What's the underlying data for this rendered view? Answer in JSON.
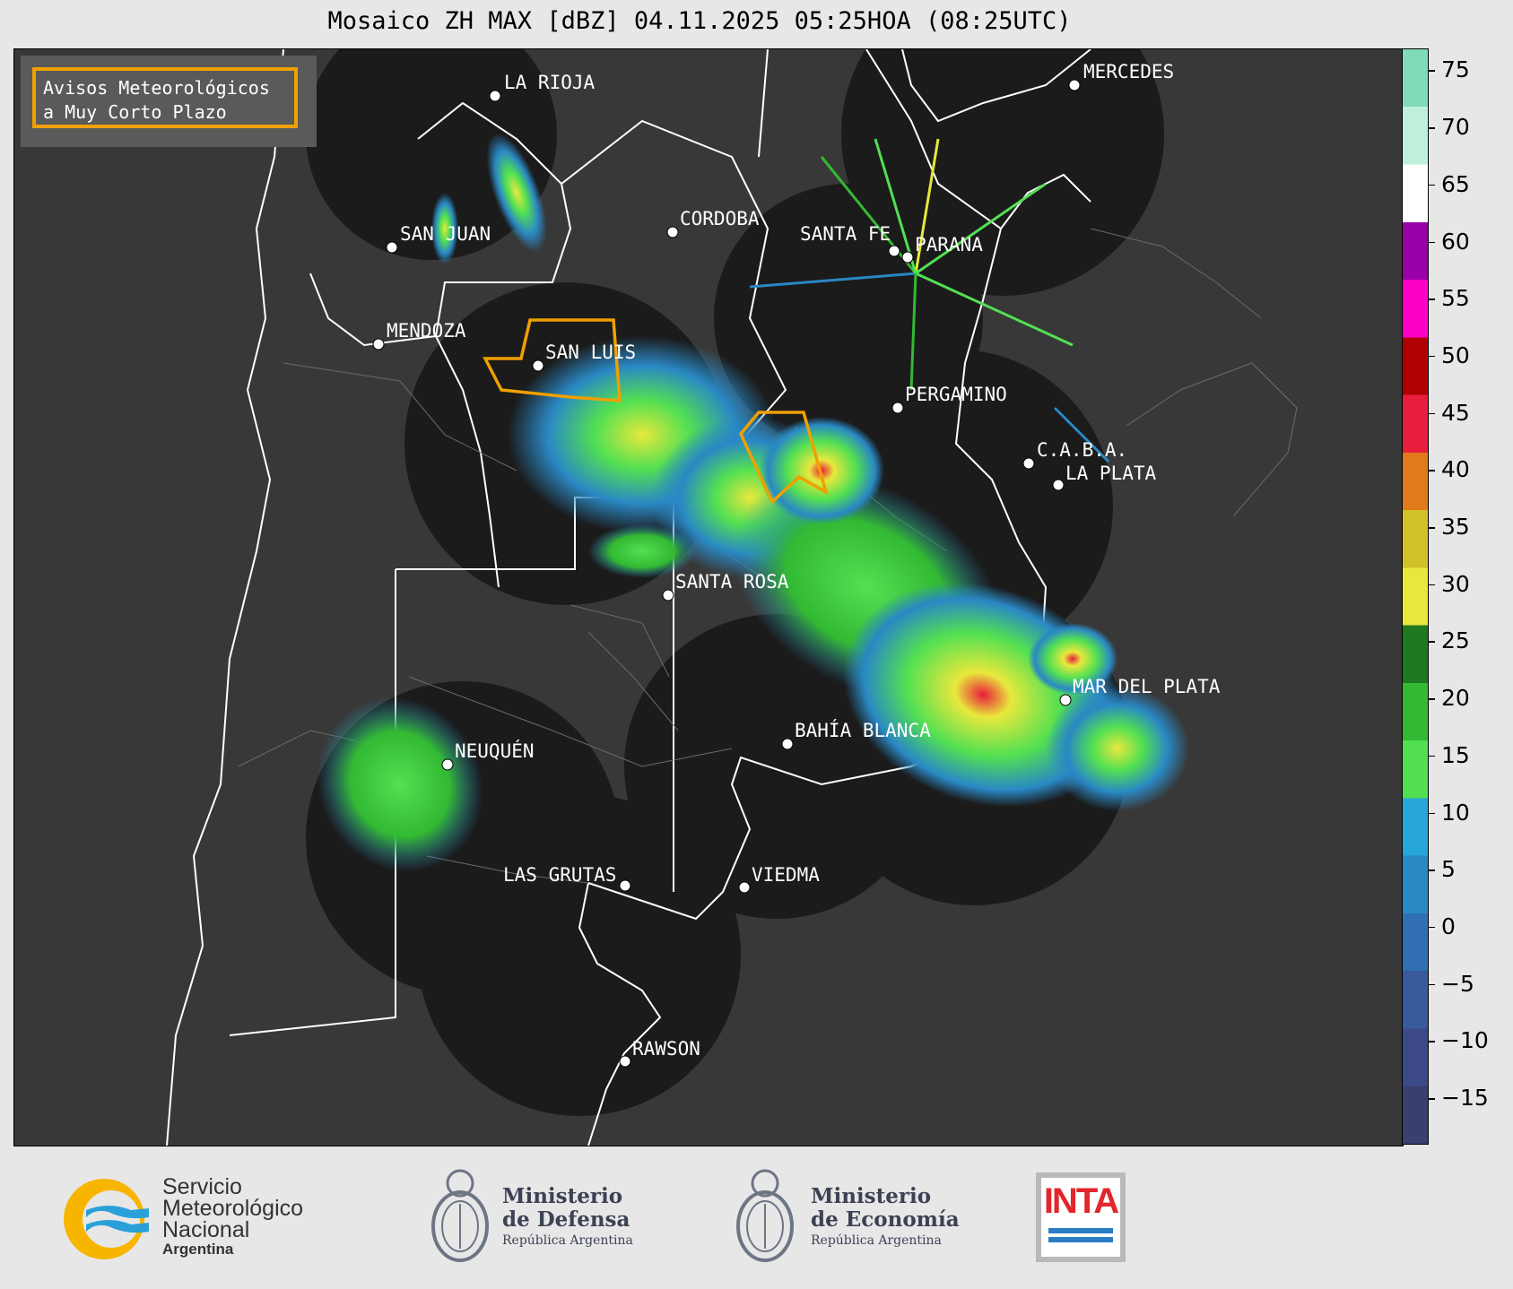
{
  "title": "Mosaico ZH MAX [dBZ] 04.11.2025 05:25HOA (08:25UTC)",
  "legend": {
    "line1": "Avisos Meteorológicos",
    "line2": "a Muy Corto Plazo",
    "warning_color": "#f0a000"
  },
  "cities": [
    {
      "name": "LA RIOJA"
    },
    {
      "name": "MERCEDES"
    },
    {
      "name": "SAN JUAN"
    },
    {
      "name": "CORDOBA"
    },
    {
      "name": "SANTA FE"
    },
    {
      "name": "PARANA"
    },
    {
      "name": "MENDOZA"
    },
    {
      "name": "SAN LUIS"
    },
    {
      "name": "PERGAMINO"
    },
    {
      "name": "C.A.B.A."
    },
    {
      "name": "LA PLATA"
    },
    {
      "name": "SANTA ROSA"
    },
    {
      "name": "MAR DEL PLATA"
    },
    {
      "name": "BAHÍA BLANCA"
    },
    {
      "name": "NEUQUÉN"
    },
    {
      "name": "LAS GRUTAS"
    },
    {
      "name": "VIEDMA"
    },
    {
      "name": "RAWSON"
    }
  ],
  "colorbar": {
    "range": [
      -19,
      77
    ],
    "ticks": [
      "75",
      "70",
      "65",
      "60",
      "55",
      "50",
      "45",
      "40",
      "35",
      "30",
      "25",
      "20",
      "15",
      "10",
      "5",
      "0",
      "−5",
      "−10",
      "−15"
    ],
    "colors": [
      "#3a3f6e",
      "#3b4a86",
      "#3a5a9e",
      "#2f6fb2",
      "#2a88c4",
      "#27a6d9",
      "#52e052",
      "#33b933",
      "#1f7a1f",
      "#e8e83c",
      "#d2c229",
      "#e07a1a",
      "#e81e3c",
      "#b00000",
      "#ff00c8",
      "#9a00a8",
      "#ffffff",
      "#bff0dc",
      "#7fdcb6"
    ]
  },
  "logos": {
    "smn": {
      "line1": "Servicio",
      "line2": "Meteorológico",
      "line3": "Nacional",
      "line4": "Argentina"
    },
    "defensa": {
      "line1": "Ministerio",
      "line2": "de Defensa",
      "line3": "República Argentina"
    },
    "economia": {
      "line1": "Ministerio",
      "line2": "de Economía",
      "line3": "República Argentina"
    },
    "inta": {
      "text": "INTA"
    }
  }
}
